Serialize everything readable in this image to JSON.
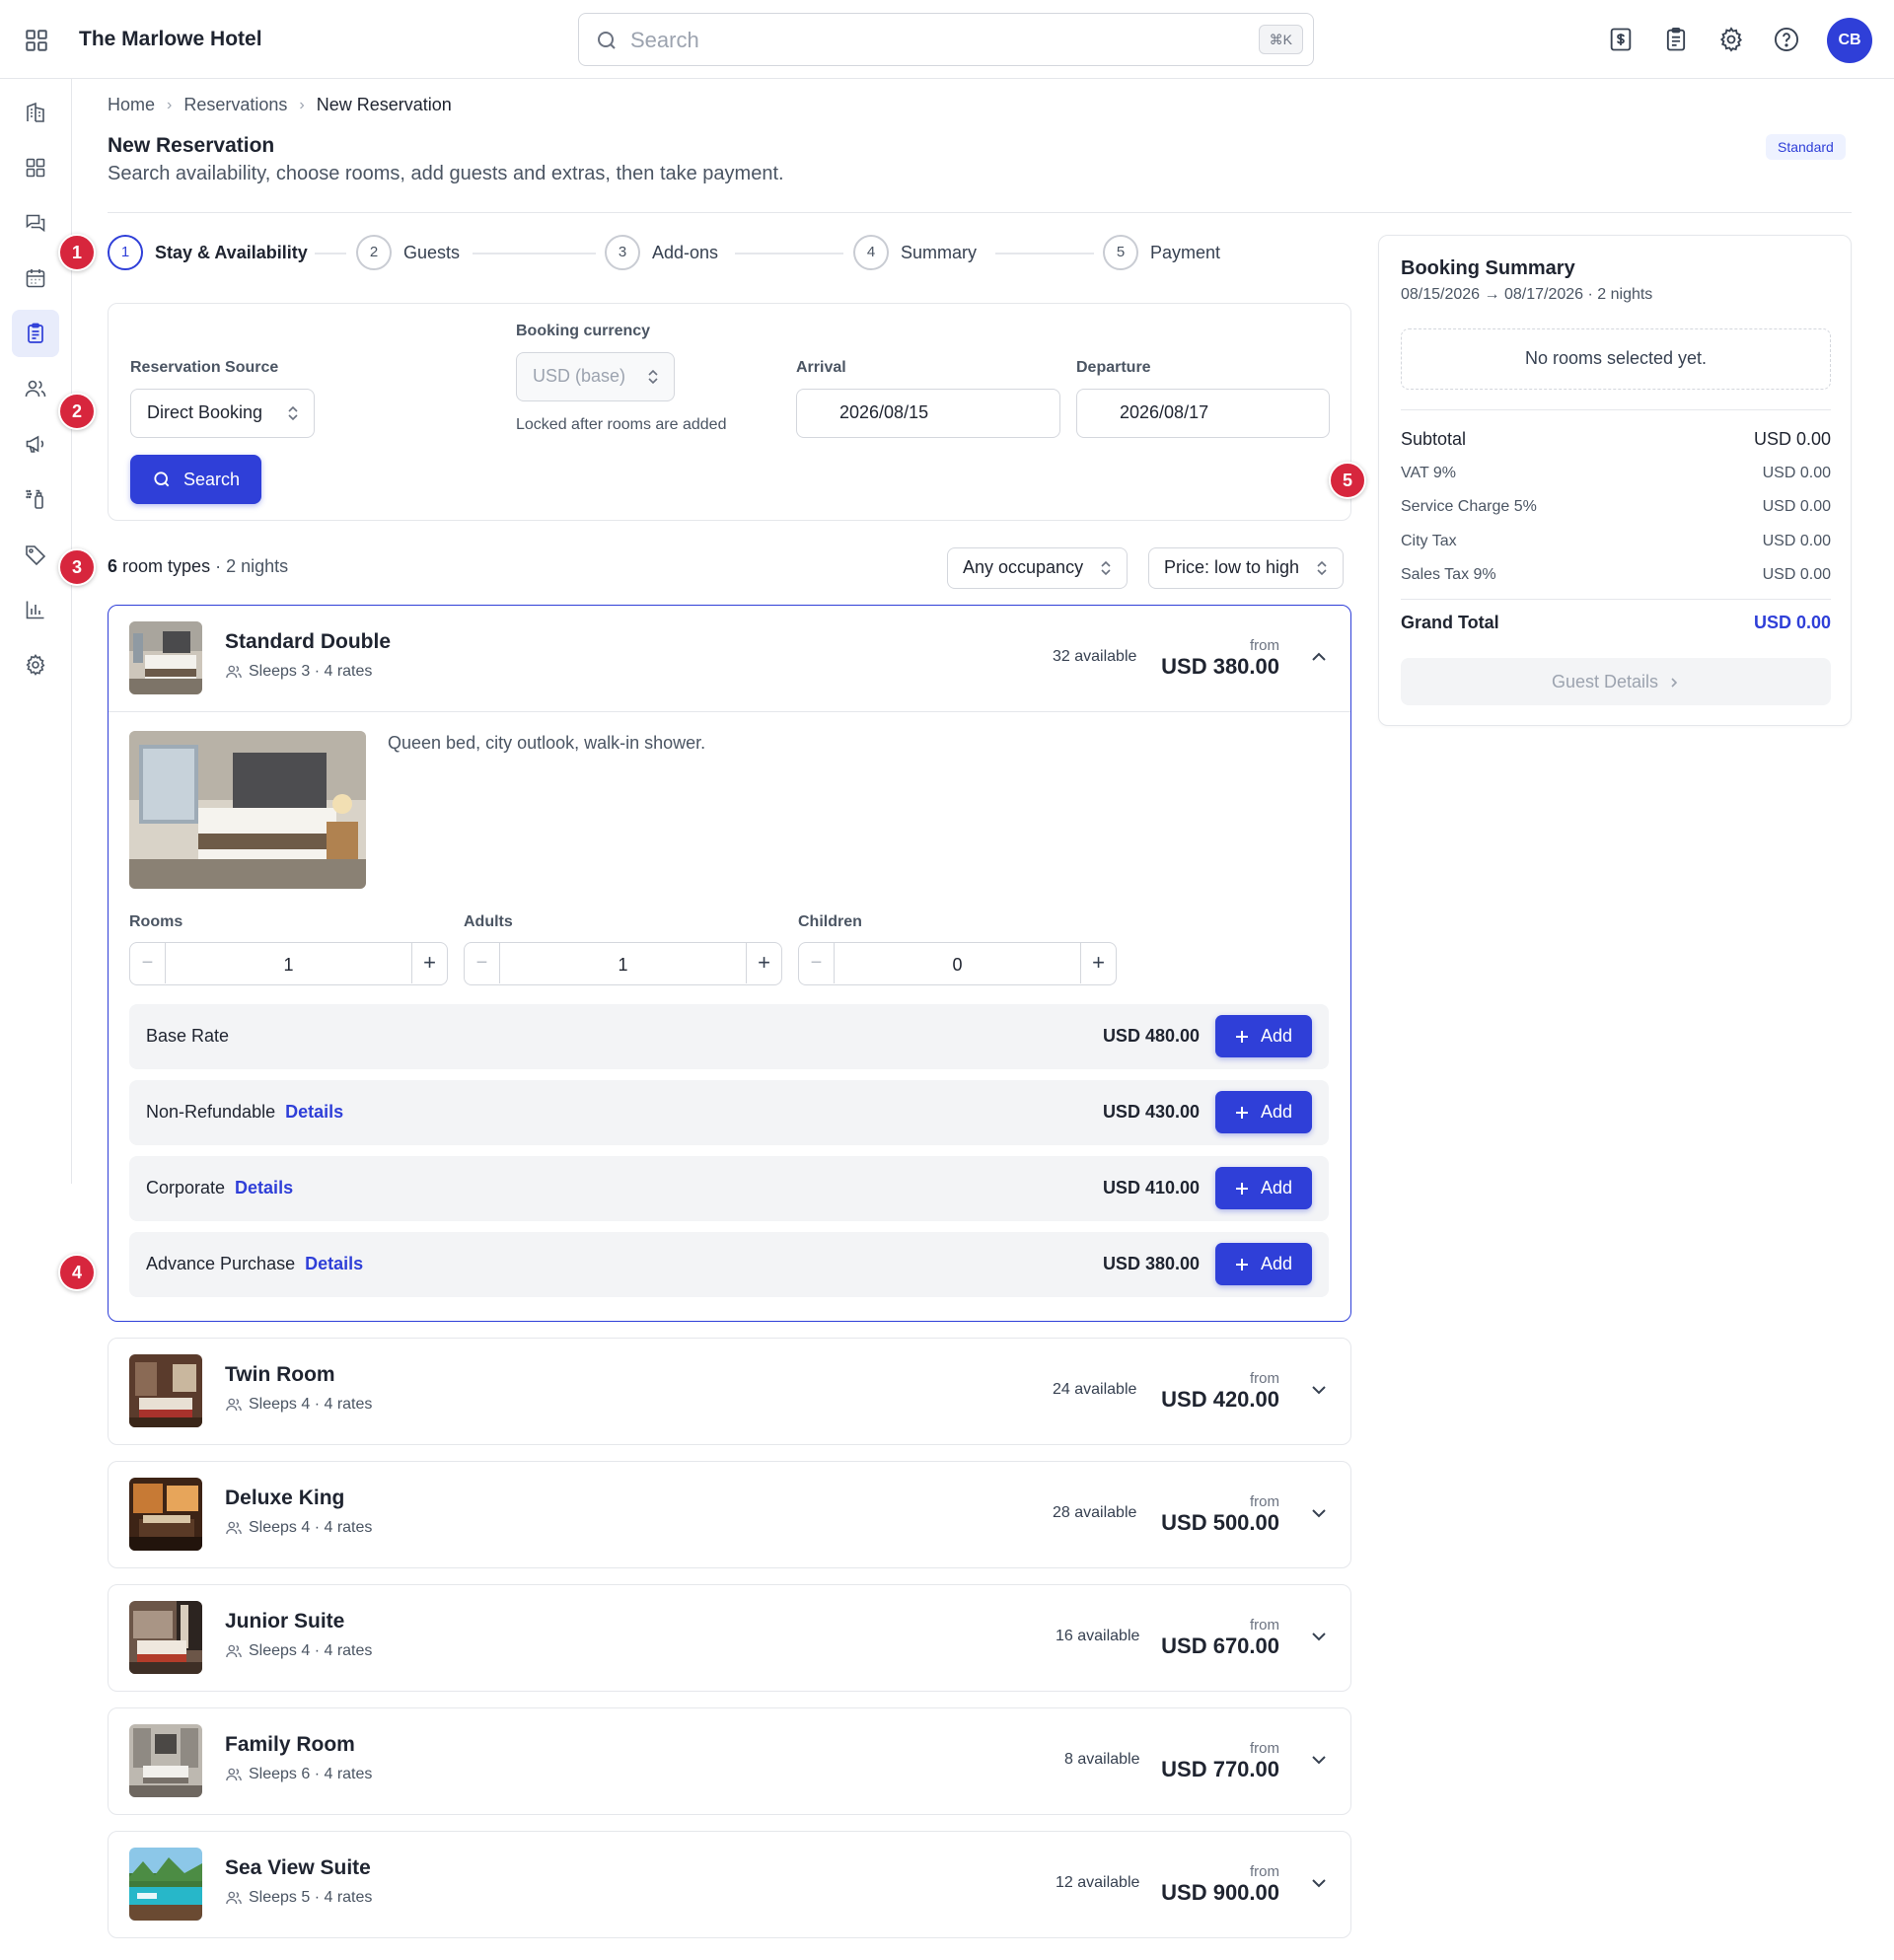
{
  "app": {
    "title": "The Marlowe Hotel"
  },
  "search": {
    "placeholder": "Search",
    "shortcut": "⌘K"
  },
  "user": {
    "initials": "CB"
  },
  "toolbar_icons": [
    "dollar-receipt-icon",
    "clipboard-icon",
    "gear-icon",
    "help-icon"
  ],
  "sidebar_icons": [
    "hotel-icon",
    "dashboard-icon",
    "messages-icon",
    "calendar-icon",
    "reservations-icon",
    "guests-icon",
    "marketing-icon",
    "housekeeping-icon",
    "tag-icon",
    "reports-icon",
    "settings-icon"
  ],
  "colors": {
    "primary": "#2f3fd8",
    "marker": "#d7263d",
    "tier_bg": "#eef2ff"
  },
  "markers": [
    "1",
    "2",
    "3",
    "4",
    "5"
  ],
  "breadcrumb": {
    "home": "Home",
    "reservations": "Reservations",
    "current": "New Reservation"
  },
  "page": {
    "title": "New Reservation",
    "subtitle": "Search availability, choose rooms, add guests and extras, then take payment.",
    "tier": "Standard"
  },
  "steps": [
    {
      "num": "1",
      "label": "Stay & Availability"
    },
    {
      "num": "2",
      "label": "Guests"
    },
    {
      "num": "3",
      "label": "Add-ons"
    },
    {
      "num": "4",
      "label": "Summary"
    },
    {
      "num": "5",
      "label": "Payment"
    }
  ],
  "form": {
    "source_label": "Reservation Source",
    "source_value": "Direct Booking",
    "currency_label": "Booking currency",
    "currency_value": "USD (base)",
    "currency_hint": "Locked after rooms are added",
    "arrival_label": "Arrival",
    "arrival_value": "2026/08/15",
    "departure_label": "Departure",
    "departure_value": "2026/08/17",
    "search_label": "Search"
  },
  "results": {
    "count": "6",
    "count_suffix": "room types",
    "nights": "· 2 nights",
    "occupancy_filter": "Any occupancy",
    "sort": "Price: low to high"
  },
  "from_label": "from",
  "rooms": [
    {
      "name": "Standard Double",
      "sleeps": "Sleeps 3 · 4 rates",
      "available": "32 available",
      "price": "USD 380.00"
    },
    {
      "name": "Twin Room",
      "sleeps": "Sleeps 4 · 4 rates",
      "available": "24 available",
      "price": "USD 420.00"
    },
    {
      "name": "Deluxe King",
      "sleeps": "Sleeps 4 · 4 rates",
      "available": "28 available",
      "price": "USD 500.00"
    },
    {
      "name": "Junior Suite",
      "sleeps": "Sleeps 4 · 4 rates",
      "available": "16 available",
      "price": "USD 670.00"
    },
    {
      "name": "Family Room",
      "sleeps": "Sleeps 6 · 4 rates",
      "available": "8 available",
      "price": "USD 770.00"
    },
    {
      "name": "Sea View Suite",
      "sleeps": "Sleeps 5 · 4 rates",
      "available": "12 available",
      "price": "USD 900.00"
    }
  ],
  "expanded": {
    "description": "Queen bed, city outlook, walk-in shower.",
    "rooms_label": "Rooms",
    "rooms_value": "1",
    "adults_label": "Adults",
    "adults_value": "1",
    "children_label": "Children",
    "children_value": "0",
    "add_label": "Add",
    "details_label": "Details",
    "rates": [
      {
        "name": "Base Rate",
        "price": "USD 480.00"
      },
      {
        "name": "Non-Refundable",
        "price": "USD 430.00"
      },
      {
        "name": "Corporate",
        "price": "USD 410.00"
      },
      {
        "name": "Advance Purchase",
        "price": "USD 380.00"
      }
    ]
  },
  "summary": {
    "title": "Booking Summary",
    "dates": "08/15/2026 → 08/17/2026 · 2 nights",
    "empty": "No rooms selected yet.",
    "subtotal_label": "Subtotal",
    "subtotal": "USD 0.00",
    "vat_label": "VAT 9%",
    "vat": "USD 0.00",
    "service_label": "Service Charge 5%",
    "service": "USD 0.00",
    "city_label": "City Tax",
    "city": "USD 0.00",
    "sales_label": "Sales Tax 9%",
    "sales": "USD 0.00",
    "total_label": "Grand Total",
    "total": "USD 0.00",
    "next_label": "Guest Details"
  }
}
